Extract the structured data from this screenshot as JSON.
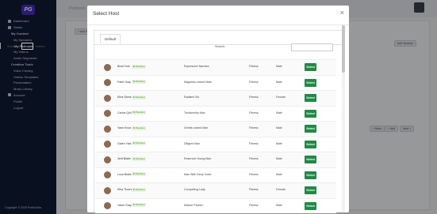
{
  "app": {
    "logo_text": "PG",
    "copyright": "Copyright © 2025 PodGorilla.",
    "background_title": "Podcasts"
  },
  "sidebar": {
    "items": [
      {
        "label": "Dashboard",
        "level": 0,
        "icon": "dashboard-icon"
      },
      {
        "label": "Studio",
        "level": 0,
        "icon": "studio-icon"
      },
      {
        "label": "My Content",
        "level": 1
      },
      {
        "label": "My Speakers",
        "level": 2
      },
      {
        "label": "My Podcasts",
        "level": 2,
        "active": true
      },
      {
        "label": "My Videos",
        "level": 2
      },
      {
        "label": "Audio Segments",
        "level": 2
      },
      {
        "label": "Creation Tools",
        "level": 1
      },
      {
        "label": "Voice Cloning",
        "level": 2
      },
      {
        "label": "Videos Templates",
        "level": 2
      },
      {
        "label": "Presentation",
        "level": 2
      },
      {
        "label": "Music Library",
        "level": 2
      },
      {
        "label": "Account",
        "level": 0,
        "icon": "account-icon"
      },
      {
        "label": "Profile",
        "level": 2
      },
      {
        "label": "Logout",
        "level": 2
      }
    ]
  },
  "background": {
    "add_button": "+ Add Podcast",
    "add_speaker": "Add Speaker",
    "footer_buttons": [
      "< Back",
      "+ Add",
      "Next >"
    ]
  },
  "modal": {
    "title": "Select Host",
    "close": "×",
    "tab": "Default",
    "show_label": "Show",
    "show_value": "10",
    "entries_label": "entries",
    "search_label": "Search:",
    "select_label": "Select",
    "premium_label": "Premium",
    "rows": [
      {
        "name": "Brad York",
        "description": "Expressive Narrator",
        "category": "Fitness",
        "gender": "Male"
      },
      {
        "name": "Patel Gray",
        "description": "Magnetic-voiced Male",
        "category": "Fitness",
        "gender": "Male"
      },
      {
        "name": "Elira Stone",
        "description": "Radiant Girl",
        "category": "Fitness",
        "gender": "Female"
      },
      {
        "name": "Carlos Quill",
        "description": "Trustworthy Man",
        "category": "Fitness",
        "gender": "Male"
      },
      {
        "name": "Yann Knox",
        "description": "Gentle-voiced Man",
        "category": "Fitness",
        "gender": "Male"
      },
      {
        "name": "Galen Yale",
        "description": "Diligent Man",
        "category": "Fitness",
        "gender": "Male"
      },
      {
        "name": "Jerit Blake",
        "description": "Reserved Young Man",
        "category": "Fitness",
        "gender": "Male"
      },
      {
        "name": "Luca Blake",
        "description": "Man With Deep Voice",
        "category": "Fitness",
        "gender": "Male"
      },
      {
        "name": "Elira Thorne",
        "description": "Compelling Lady",
        "category": "Fitness",
        "gender": "Female"
      },
      {
        "name": "Yanel Gray",
        "description": "Mature Partner",
        "category": "Fitness",
        "gender": "Male"
      }
    ]
  },
  "colors": {
    "sidebar_bg": "#101a33",
    "select_button": "#1f8a45",
    "premium_badge_bg": "#e6f4dd",
    "premium_badge_text": "#3c8a2a"
  }
}
